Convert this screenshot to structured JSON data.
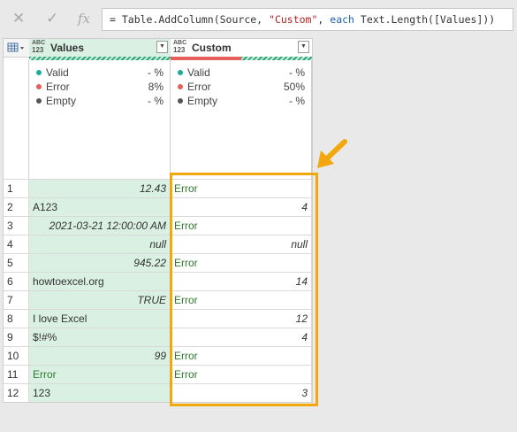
{
  "formula_bar": {
    "cancel_icon": "close-icon",
    "commit_icon": "check-icon",
    "fx_label": "fx",
    "formula_prefix": "= Table.AddColumn(Source, ",
    "formula_string": "\"Custom\"",
    "formula_mid": ", ",
    "formula_keyword": "each",
    "formula_suffix": " Text.Length([Values]))"
  },
  "columns": [
    {
      "type_line1": "ABC",
      "type_line2": "123",
      "name": "Values",
      "header_bg": "#d9f0e3"
    },
    {
      "type_line1": "ABC",
      "type_line2": "123",
      "name": "Custom",
      "header_bg": "#ffffff"
    }
  ],
  "profile": {
    "values": [
      {
        "label": "Valid",
        "pct": "- %",
        "color": "#1aab9b"
      },
      {
        "label": "Error",
        "pct": "8%",
        "color": "#e65f5a"
      },
      {
        "label": "Empty",
        "pct": "- %",
        "color": "#555555"
      }
    ],
    "custom": [
      {
        "label": "Valid",
        "pct": "- %",
        "color": "#1aab9b"
      },
      {
        "label": "Error",
        "pct": "50%",
        "color": "#e65f5a"
      },
      {
        "label": "Empty",
        "pct": "- %",
        "color": "#555555"
      }
    ],
    "custom_error_fraction": 0.5
  },
  "rows": [
    {
      "n": "1",
      "values": "12.43",
      "values_align": "right-italic",
      "custom": "Error",
      "custom_align": "error"
    },
    {
      "n": "2",
      "values": "A123",
      "values_align": "left",
      "custom": "4",
      "custom_align": "right-italic"
    },
    {
      "n": "3",
      "values": "2021-03-21 12:00:00 AM",
      "values_align": "right-italic",
      "custom": "Error",
      "custom_align": "error"
    },
    {
      "n": "4",
      "values": "null",
      "values_align": "right-italic",
      "custom": "null",
      "custom_align": "right-italic"
    },
    {
      "n": "5",
      "values": "945.22",
      "values_align": "right-italic",
      "custom": "Error",
      "custom_align": "error"
    },
    {
      "n": "6",
      "values": "howtoexcel.org",
      "values_align": "left",
      "custom": "14",
      "custom_align": "right-italic"
    },
    {
      "n": "7",
      "values": "TRUE",
      "values_align": "right-italic",
      "custom": "Error",
      "custom_align": "error"
    },
    {
      "n": "8",
      "values": "I love Excel",
      "values_align": "left",
      "custom": "12",
      "custom_align": "right-italic"
    },
    {
      "n": "9",
      "values": "$!#%",
      "values_align": "left",
      "custom": "4",
      "custom_align": "right-italic"
    },
    {
      "n": "10",
      "values": "99",
      "values_align": "right-italic",
      "custom": "Error",
      "custom_align": "error"
    },
    {
      "n": "11",
      "values": "Error",
      "values_align": "error",
      "custom": "Error",
      "custom_align": "error"
    },
    {
      "n": "12",
      "values": "123",
      "values_align": "left",
      "custom": "3",
      "custom_align": "right-italic"
    }
  ],
  "annotation": {
    "highlight_color": "#f2a80d",
    "arrow_icon": "arrow-down-left-icon"
  }
}
